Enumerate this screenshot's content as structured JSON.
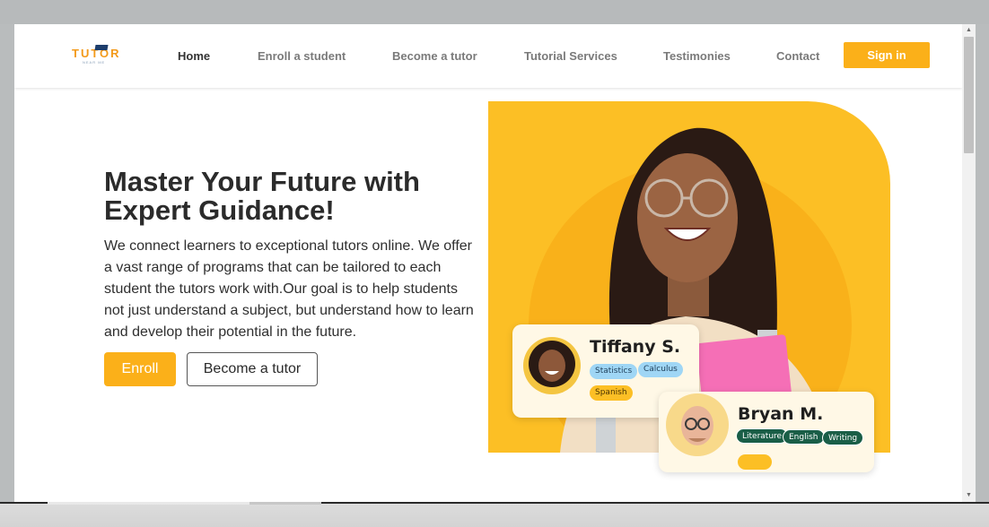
{
  "nav": {
    "logo_text": "TUTOR",
    "logo_sub": "NEAR ME",
    "links": [
      {
        "label": "Home"
      },
      {
        "label": "Enroll a student"
      },
      {
        "label": "Become a tutor"
      },
      {
        "label": "Tutorial Services"
      },
      {
        "label": "Testimonies"
      },
      {
        "label": "Contact"
      }
    ],
    "signin_label": "Sign in"
  },
  "hero": {
    "title": "Master Your Future with Expert Guidance!",
    "text": "We connect learners to exceptional tutors online. We offer a vast range of programs that can be tailored to each student the tutors work with.Our goal is to help students not just understand a subject, but understand how to learn and develop their potential in the future.",
    "enroll_label": "Enroll",
    "become_tutor_label": "Become a tutor"
  },
  "cards": {
    "tiffany": {
      "name": "Tiffany S.",
      "chips": [
        "Statistics",
        "Calculus",
        "Spanish"
      ]
    },
    "bryan": {
      "name": "Bryan M.",
      "chips": [
        "Literature",
        "English",
        "Writing"
      ]
    }
  },
  "colors": {
    "accent": "#fbb019",
    "hero_bg": "#fcbf25"
  }
}
